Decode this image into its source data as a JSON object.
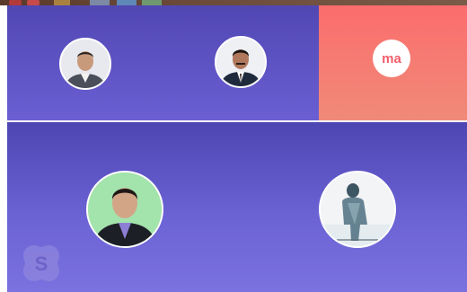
{
  "call": {
    "participants": [
      {
        "type": "photo",
        "icon": "person-photo-man-gray-suit"
      },
      {
        "type": "photo",
        "icon": "person-photo-man-dark-suit"
      },
      {
        "type": "initials",
        "initials": "ma",
        "tile_color": "#fb6d6d"
      },
      {
        "type": "photo",
        "icon": "person-photo-man-green-background"
      },
      {
        "type": "photo",
        "icon": "person-photo-silhouette-walking"
      }
    ],
    "logo": "skype-logo-icon"
  },
  "colors": {
    "tile_purple": "#5f56c6",
    "tile_coral": "#fb6d6d",
    "initials_text": "#f25e6b"
  }
}
